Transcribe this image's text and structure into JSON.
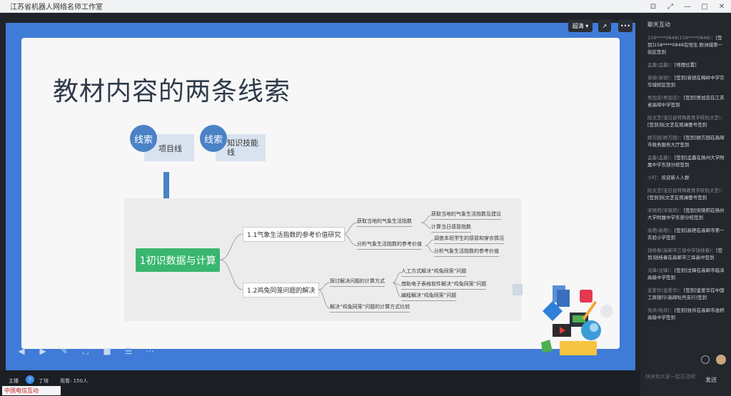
{
  "window": {
    "title": "江苏省机器人网络名师工作室",
    "controls": [
      "—",
      "□",
      "✕"
    ]
  },
  "player": {
    "quality": "超清 ▾",
    "share_icon": "share-icon",
    "more_icon": "more-icon"
  },
  "slide": {
    "title": "教材内容的两条线索",
    "circle1": "线索",
    "card1": "项目线",
    "circle2": "线索",
    "card2": "知识技能线",
    "root": "1初识数据与计算",
    "branch1": "1.1气象生活指数的参考价值研究",
    "branch2": "1.2鸡兔同笼问题的解决",
    "b1_sub1": "获取当地的气象生活指数",
    "b1_sub2": "分析气象生活指数的参考价值",
    "b1_leaf1": "获取当地的气象生活指数及建议",
    "b1_leaf2": "计算当日感冒指数",
    "b1_leaf3": "调查本班学生的感冒和穿衣情况",
    "b1_leaf4": "分析气象生活指数的参考价值",
    "b2_sub1": "探讨解决问题的计算方式",
    "b2_sub2": "解决“鸡兔同笼”问题的计算方式比较",
    "b2_leaf1": "人工方式解决“鸡兔同笼”问题",
    "b2_leaf2": "借助电子表格软件解决“鸡兔同笼”问题",
    "b2_leaf3": "编程解决“鸡兔同笼”问题"
  },
  "bottom": {
    "host_label": "主播",
    "host_name": "丁琦",
    "viewers": "观看: 150人",
    "logo_text": "中国电信互动"
  },
  "chat": {
    "header": "聊天互动",
    "messages": [
      {
        "user": "158****0848(158****0848)：",
        "text": "[签到]158****0848在恒生.欧洲城第一街区签到"
      },
      {
        "user": "孟鑫(孟鑫)：",
        "text": "[地理位置]"
      },
      {
        "user": "袁锐(袁锐)：",
        "text": "[签到]袁锐在梅岭中学京华城校区签到"
      },
      {
        "user": "吴加忠(吴加忠)：",
        "text": "[签到]吴加忠在江苏省高邮中学签到"
      },
      {
        "user": "阮文芝(宝应县特殊教育学校阮文芝)：",
        "text": "[签到]阮文芝在观澜壹号签到"
      },
      {
        "user": "顾方园(顾方园)：",
        "text": "[签到]顾方园在高邮市政务服务大厅签到"
      },
      {
        "user": "孟鑫(孟鑫)：",
        "text": "[签到]孟鑫在扬州大学附属中学东部分校签到"
      },
      {
        "user": "小叮：",
        "text": "欢迎新人入群"
      },
      {
        "user": "阮文芝(宝应县特殊教育学校阮文芝)：",
        "text": "[签到]阮文芝在观澜壹号签到"
      },
      {
        "user": "宋晓莉(宋晓莉)：",
        "text": "[签到]宋晓莉在扬州大学附属中学东部分校签到"
      },
      {
        "user": "高艳(高艳)：",
        "text": "[签到]高艳在高邮市第一实验小学签到"
      },
      {
        "user": "钱桂春(高邮市三垛中学钱桂春)：",
        "text": "[签到]钱桂春在高邮市三垛高中签到"
      },
      {
        "user": "沈锋(沈锋)：",
        "text": "[签到]沈锋在高邮市临泽高级中学签到"
      },
      {
        "user": "金爱华(金爱华)：",
        "text": "[签到]金爱华在中国工商银行(高邮牡丹支行)签到"
      },
      {
        "user": "张兵(张兵)：",
        "text": "[签到]张兵在高邮市送桥高级中学签到"
      }
    ],
    "input_placeholder": "快来和大家一起互动吧",
    "send_label": "发送"
  },
  "colors": {
    "stage_blue": "#3f7bd7",
    "circle_blue": "#4a82c6",
    "root_green": "#39b66f"
  }
}
